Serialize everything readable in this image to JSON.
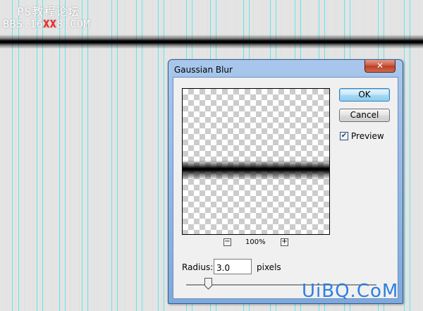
{
  "watermark_top": {
    "line1": "PS教程论坛",
    "line2_prefix": "BBS.16",
    "line2_red": "XX",
    "line2_suffix": "8.COM"
  },
  "dialog": {
    "title": "Gaussian Blur",
    "close_label": "✕",
    "ok_label": "OK",
    "cancel_label": "Cancel",
    "preview_label": "Preview",
    "preview_checked": true,
    "zoom_out_label": "−",
    "zoom_in_label": "+",
    "zoom_level": "100%",
    "radius_label": "Radius:",
    "radius_value": "3.0",
    "radius_unit": "pixels",
    "slider_fraction": 0.115
  },
  "watermark_bottom": "UiBQ.CoM",
  "colors": {
    "guide": "#63e6ea",
    "title_bar": "#a9c7ec",
    "watermark_blue": "#2f7fe0"
  },
  "icons": {
    "close": "close-icon",
    "check": "checkmark-icon",
    "zoom_out": "minus-icon",
    "zoom_in": "plus-icon",
    "slider_thumb": "slider-thumb-icon"
  }
}
